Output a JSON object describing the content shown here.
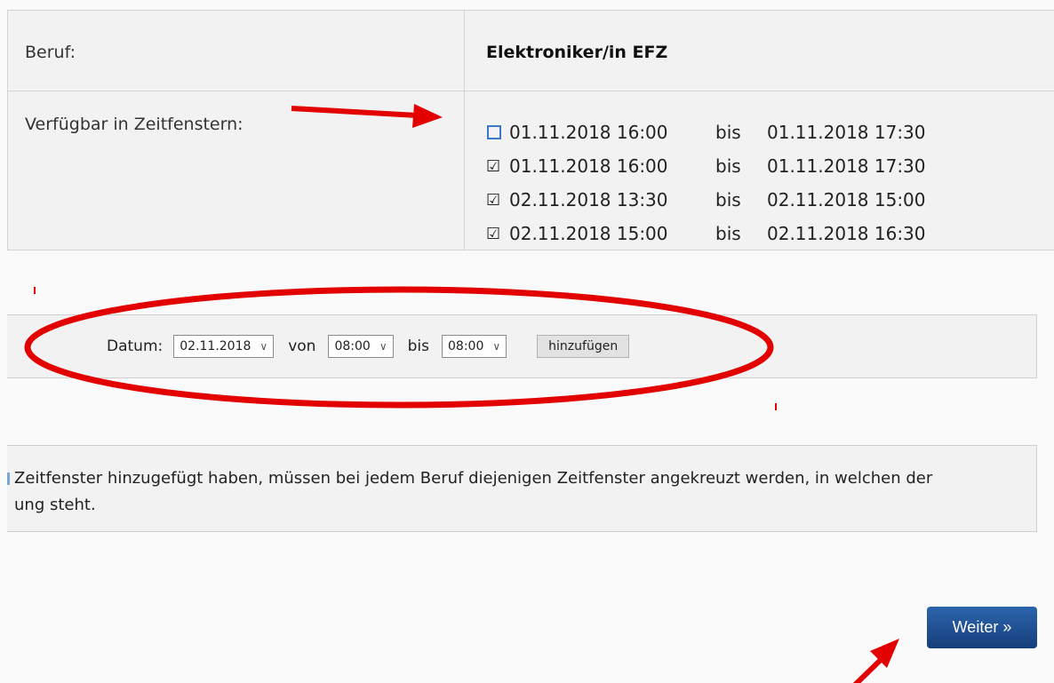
{
  "info": {
    "beruf_label": "Beruf:",
    "beruf_value": "Elektroniker/in EFZ",
    "zeitfenster_label": "Verfügbar in Zeitfenstern:",
    "slots": [
      {
        "checked": false,
        "from": "01.11.2018 16:00",
        "sep": "bis",
        "to": "01.11.2018 17:30"
      },
      {
        "checked": true,
        "from": "01.11.2018 16:00",
        "sep": "bis",
        "to": "01.11.2018 17:30"
      },
      {
        "checked": true,
        "from": "02.11.2018 13:30",
        "sep": "bis",
        "to": "02.11.2018 15:00"
      },
      {
        "checked": true,
        "from": "02.11.2018 15:00",
        "sep": "bis",
        "to": "02.11.2018 16:30"
      }
    ]
  },
  "add_form": {
    "datum_label": "Datum:",
    "datum_value": "02.11.2018",
    "von_label": "von",
    "von_value": "08:00",
    "bis_label": "bis",
    "bis_value": "08:00",
    "add_button": "hinzufügen"
  },
  "note": {
    "line1": "Zeitfenster hinzugefügt haben, müssen bei jedem Beruf diejenigen Zeitfenster angekreuzt werden, in welchen der",
    "line2": "ung steht."
  },
  "weiter_button": "Weiter »",
  "colors": {
    "annotation": "#e20000",
    "primary_button": "#1f4f93",
    "checkbox_accent": "#3a78c8"
  }
}
